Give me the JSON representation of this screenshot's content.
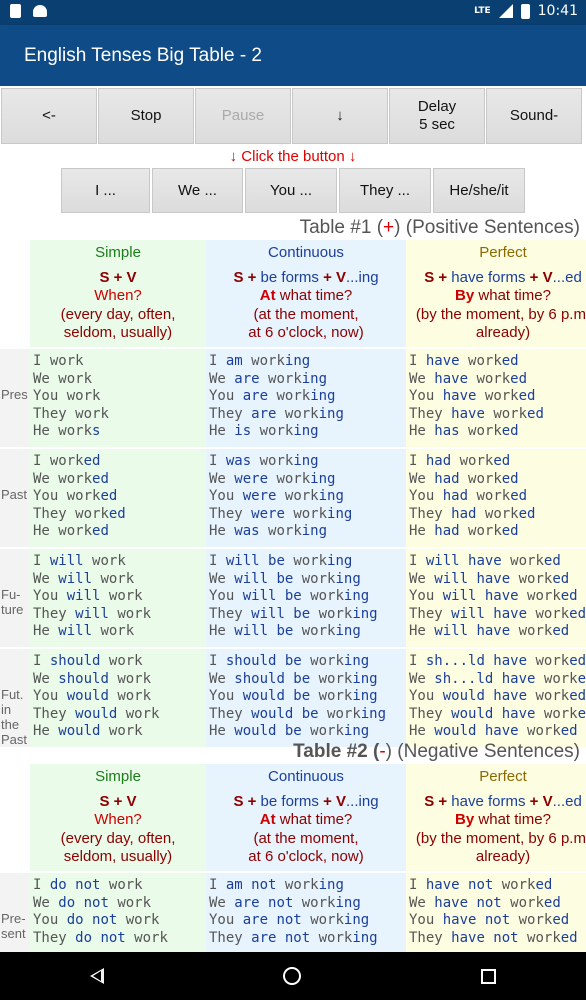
{
  "status": {
    "time": "10:41",
    "network": "LTE"
  },
  "appbar": {
    "title": "English Tenses Big Table - 2"
  },
  "toolbar": {
    "back": "<-",
    "stop": "Stop",
    "pause": "Pause",
    "down": "↓",
    "delay_line1": "Delay",
    "delay_line2": "5 sec",
    "sound": "Sound-"
  },
  "hint": "↓ Click the button ↓",
  "pronouns": [
    "I ...",
    "We ...",
    "You ...",
    "They ...",
    "He/she/it"
  ],
  "table1": {
    "title_pre": "Table #1 (",
    "sign": "+",
    "title_post": ") (Positive Sentences)",
    "headers": {
      "simple": {
        "name": "Simple",
        "form": "S + V",
        "q": "When?",
        "ex1": "(every day, often,",
        "ex2": "seldom, usually)"
      },
      "continuous": {
        "name": "Continuous",
        "form_s": "S + ",
        "form_be": "be forms",
        "form_plus": " + V",
        "form_ing": "...ing",
        "q_kw": "At",
        "q_rest": " what time?",
        "ex1": "(at the moment,",
        "ex2": "at 6 o'clock, now)"
      },
      "perfect": {
        "name": "Perfect",
        "form_s": "S + ",
        "form_have": "have forms",
        "form_plus": " + V",
        "form_ed": "...ed",
        "q_kw": "By",
        "q_rest": " what time?",
        "ex1": "(by the moment, by 6 p.m.",
        "ex2": "already)"
      }
    },
    "rows": [
      {
        "label": "Pres",
        "simple": [
          [
            "I",
            "",
            "work",
            ""
          ],
          [
            "We",
            "",
            "work",
            ""
          ],
          [
            "You",
            "",
            "work",
            ""
          ],
          [
            "They",
            "",
            "work",
            ""
          ],
          [
            "He",
            "",
            "work",
            "s"
          ]
        ],
        "cont": [
          [
            "I",
            "am",
            "work",
            "ing"
          ],
          [
            "We",
            "are",
            "work",
            "ing"
          ],
          [
            "You",
            "are",
            "work",
            "ing"
          ],
          [
            "They",
            "are",
            "work",
            "ing"
          ],
          [
            "He",
            "is",
            "work",
            "ing"
          ]
        ],
        "perf": [
          [
            "I",
            "have",
            "work",
            "ed"
          ],
          [
            "We",
            "have",
            "work",
            "ed"
          ],
          [
            "You",
            "have",
            "work",
            "ed"
          ],
          [
            "They",
            "have",
            "work",
            "ed"
          ],
          [
            "He",
            "has",
            "work",
            "ed"
          ]
        ]
      },
      {
        "label": "Past",
        "simple": [
          [
            "I",
            "",
            "work",
            "ed"
          ],
          [
            "We",
            "",
            "work",
            "ed"
          ],
          [
            "You",
            "",
            "work",
            "ed"
          ],
          [
            "They",
            "",
            "work",
            "ed"
          ],
          [
            "He",
            "",
            "work",
            "ed"
          ]
        ],
        "cont": [
          [
            "I",
            "was",
            "work",
            "ing"
          ],
          [
            "We",
            "were",
            "work",
            "ing"
          ],
          [
            "You",
            "were",
            "work",
            "ing"
          ],
          [
            "They",
            "were",
            "work",
            "ing"
          ],
          [
            "He",
            "was",
            "work",
            "ing"
          ]
        ],
        "perf": [
          [
            "I",
            "had",
            "work",
            "ed"
          ],
          [
            "We",
            "had",
            "work",
            "ed"
          ],
          [
            "You",
            "had",
            "work",
            "ed"
          ],
          [
            "They",
            "had",
            "work",
            "ed"
          ],
          [
            "He",
            "had",
            "work",
            "ed"
          ]
        ]
      },
      {
        "label": "Fu-ture",
        "simple": [
          [
            "I",
            "will",
            "work",
            ""
          ],
          [
            "We",
            "will",
            "work",
            ""
          ],
          [
            "You",
            "will",
            "work",
            ""
          ],
          [
            "They",
            "will",
            "work",
            ""
          ],
          [
            "He",
            "will",
            "work",
            ""
          ]
        ],
        "cont": [
          [
            "I",
            "will be",
            "work",
            "ing"
          ],
          [
            "We",
            "will be",
            "work",
            "ing"
          ],
          [
            "You",
            "will be",
            "work",
            "ing"
          ],
          [
            "They",
            "will be",
            "work",
            "ing"
          ],
          [
            "He",
            "will be",
            "work",
            "ing"
          ]
        ],
        "perf": [
          [
            "I",
            "will have",
            "work",
            "ed"
          ],
          [
            "We",
            "will have",
            "work",
            "ed"
          ],
          [
            "You",
            "will have",
            "work",
            "ed"
          ],
          [
            "They",
            "will have",
            "work",
            "ed"
          ],
          [
            "He",
            "will have",
            "work",
            "ed"
          ]
        ]
      },
      {
        "label": "Fut. in the Past",
        "simple": [
          [
            "I",
            "should",
            "work",
            ""
          ],
          [
            "We",
            "should",
            "work",
            ""
          ],
          [
            "You",
            "would",
            "work",
            ""
          ],
          [
            "They",
            "would",
            "work",
            ""
          ],
          [
            "He",
            "would",
            "work",
            ""
          ]
        ],
        "cont": [
          [
            "I",
            "should be",
            "work",
            "ing"
          ],
          [
            "We",
            "should be",
            "work",
            "ing"
          ],
          [
            "You",
            "would  be",
            "work",
            "ing"
          ],
          [
            "They",
            "would  be",
            "work",
            "ing"
          ],
          [
            "He",
            "would  be",
            "work",
            "ing"
          ]
        ],
        "perf": [
          [
            "I",
            "sh...ld have",
            "work",
            "ed"
          ],
          [
            "We",
            "sh...ld have",
            "work",
            "ed"
          ],
          [
            "You",
            "would have",
            "work",
            "ed"
          ],
          [
            "They",
            "would have",
            "work",
            "ed"
          ],
          [
            "He",
            "would have",
            "work",
            "ed"
          ]
        ]
      }
    ]
  },
  "table2": {
    "title_pre": "Table #2 (",
    "sign": "-",
    "title_post": ") (Negative Sentences)",
    "rows": [
      {
        "label": "Pre-sent",
        "simple": [
          [
            "I",
            "do not",
            "work",
            ""
          ],
          [
            "We",
            "do not",
            "work",
            ""
          ],
          [
            "You",
            "do not",
            "work",
            ""
          ],
          [
            "They",
            "do not",
            "work",
            ""
          ]
        ],
        "cont": [
          [
            "I",
            "am not",
            "work",
            "ing"
          ],
          [
            "We",
            "are not",
            "work",
            "ing"
          ],
          [
            "You",
            "are not",
            "work",
            "ing"
          ],
          [
            "They",
            "are not",
            "work",
            "ing"
          ]
        ],
        "perf": [
          [
            "I",
            "have not",
            "work",
            "ed"
          ],
          [
            "We",
            "have not",
            "work",
            "ed"
          ],
          [
            "You",
            "have not",
            "work",
            "ed"
          ],
          [
            "They",
            "have not",
            "work",
            "ed"
          ]
        ]
      }
    ]
  }
}
